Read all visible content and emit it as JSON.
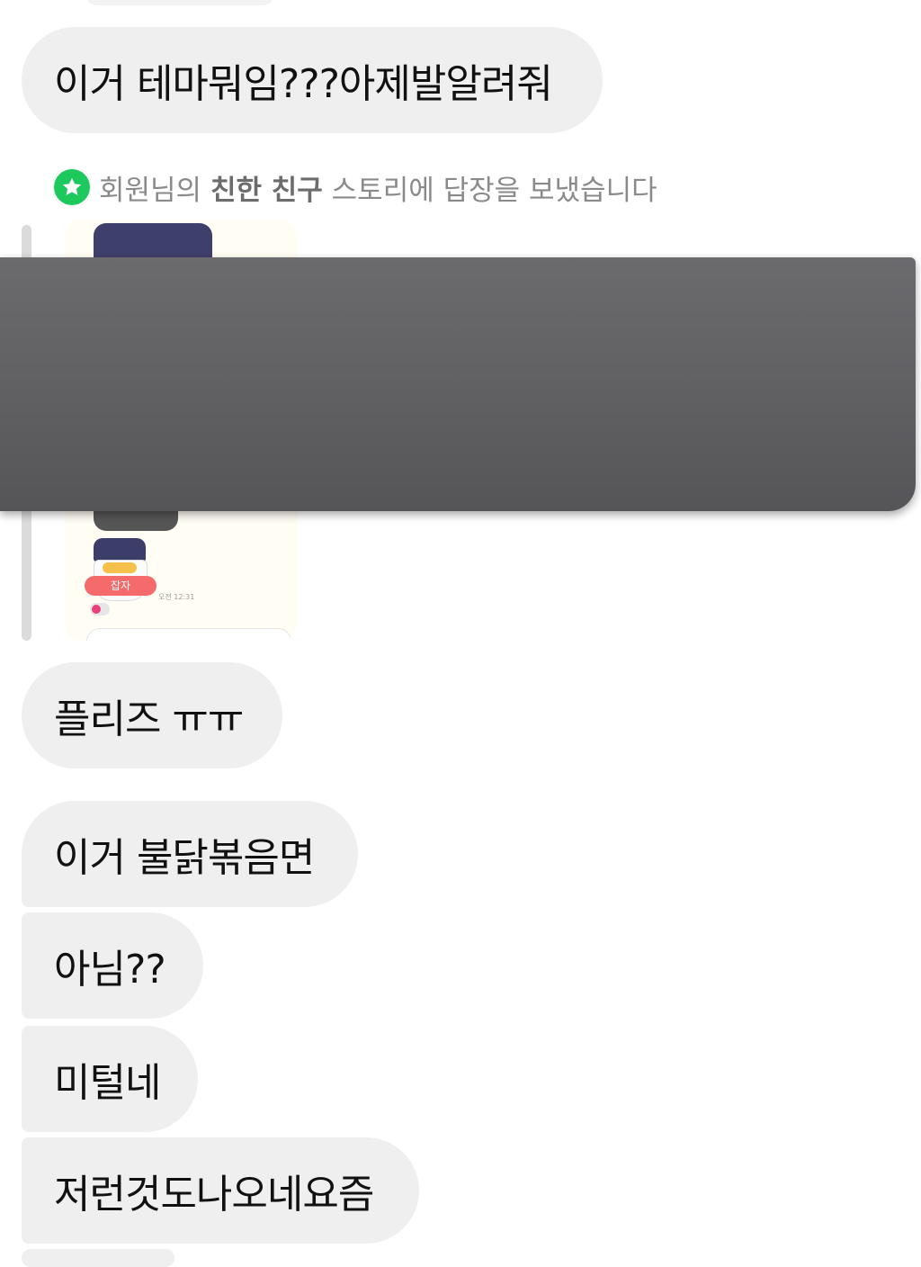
{
  "messages": [
    {
      "text": "이거 테마뭐임???아제발알려줘"
    },
    {
      "text": "플리즈 ㅠㅠ"
    },
    {
      "text": "이거 불닭볶음면"
    },
    {
      "text": "아님??"
    },
    {
      "text": "미털네"
    },
    {
      "text": "저런것도나오네요즘"
    }
  ],
  "story_reply": {
    "prefix": "회원님의 ",
    "bold": "친한 친구",
    "suffix": " 스토리에 답장을 보냈습니다",
    "badge_icon": "star-icon",
    "sticker_text": "잡자",
    "timestamp": "오전 12:31"
  },
  "colors": {
    "bubble": "#efefef",
    "close_friends": "#1dc95c",
    "redaction": "#5f5f62"
  }
}
